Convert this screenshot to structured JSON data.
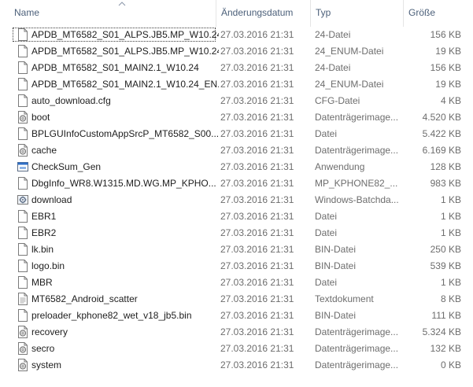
{
  "columns": {
    "name": "Name",
    "date": "Änderungsdatum",
    "type": "Typ",
    "size": "Größe"
  },
  "files": [
    {
      "name": "APDB_MT6582_S01_ALPS.JB5.MP_W10.24",
      "date": "27.03.2016 21:31",
      "type": "24-Datei",
      "size": "156 KB",
      "icon": "file-icon"
    },
    {
      "name": "APDB_MT6582_S01_ALPS.JB5.MP_W10.24....",
      "date": "27.03.2016 21:31",
      "type": "24_ENUM-Datei",
      "size": "19 KB",
      "icon": "file-icon"
    },
    {
      "name": "APDB_MT6582_S01_MAIN2.1_W10.24",
      "date": "27.03.2016 21:31",
      "type": "24-Datei",
      "size": "156 KB",
      "icon": "file-icon"
    },
    {
      "name": "APDB_MT6582_S01_MAIN2.1_W10.24_EN...",
      "date": "27.03.2016 21:31",
      "type": "24_ENUM-Datei",
      "size": "19 KB",
      "icon": "file-icon"
    },
    {
      "name": "auto_download.cfg",
      "date": "27.03.2016 21:31",
      "type": "CFG-Datei",
      "size": "4 KB",
      "icon": "file-icon"
    },
    {
      "name": "boot",
      "date": "27.03.2016 21:31",
      "type": "Datenträgerimage...",
      "size": "4.520 KB",
      "icon": "disc-image-icon"
    },
    {
      "name": "BPLGUInfoCustomAppSrcP_MT6582_S00...",
      "date": "27.03.2016 21:31",
      "type": "Datei",
      "size": "5.422 KB",
      "icon": "file-icon"
    },
    {
      "name": "cache",
      "date": "27.03.2016 21:31",
      "type": "Datenträgerimage...",
      "size": "6.169 KB",
      "icon": "disc-image-icon"
    },
    {
      "name": "CheckSum_Gen",
      "date": "27.03.2016 21:31",
      "type": "Anwendung",
      "size": "128 KB",
      "icon": "application-icon"
    },
    {
      "name": "DbgInfo_WR8.W1315.MD.WG.MP_KPHO...",
      "date": "27.03.2016 21:31",
      "type": "MP_KPHONE82_...",
      "size": "983 KB",
      "icon": "file-icon"
    },
    {
      "name": "download",
      "date": "27.03.2016 21:31",
      "type": "Windows-Batchda...",
      "size": "1 KB",
      "icon": "batch-gear-icon"
    },
    {
      "name": "EBR1",
      "date": "27.03.2016 21:31",
      "type": "Datei",
      "size": "1 KB",
      "icon": "file-icon"
    },
    {
      "name": "EBR2",
      "date": "27.03.2016 21:31",
      "type": "Datei",
      "size": "1 KB",
      "icon": "file-icon"
    },
    {
      "name": "lk.bin",
      "date": "27.03.2016 21:31",
      "type": "BIN-Datei",
      "size": "250 KB",
      "icon": "file-icon"
    },
    {
      "name": "logo.bin",
      "date": "27.03.2016 21:31",
      "type": "BIN-Datei",
      "size": "539 KB",
      "icon": "file-icon"
    },
    {
      "name": "MBR",
      "date": "27.03.2016 21:31",
      "type": "Datei",
      "size": "1 KB",
      "icon": "file-icon"
    },
    {
      "name": "MT6582_Android_scatter",
      "date": "27.03.2016 21:31",
      "type": "Textdokument",
      "size": "8 KB",
      "icon": "text-document-icon"
    },
    {
      "name": "preloader_kphone82_wet_v18_jb5.bin",
      "date": "27.03.2016 21:31",
      "type": "BIN-Datei",
      "size": "111 KB",
      "icon": "file-icon"
    },
    {
      "name": "recovery",
      "date": "27.03.2016 21:31",
      "type": "Datenträgerimage...",
      "size": "5.324 KB",
      "icon": "disc-image-icon"
    },
    {
      "name": "secro",
      "date": "27.03.2016 21:31",
      "type": "Datenträgerimage...",
      "size": "132 KB",
      "icon": "disc-image-icon"
    },
    {
      "name": "system",
      "date": "27.03.2016 21:31",
      "type": "Datenträgerimage...",
      "size": "0 KB",
      "icon": "disc-image-icon"
    }
  ],
  "selected_index": 0
}
